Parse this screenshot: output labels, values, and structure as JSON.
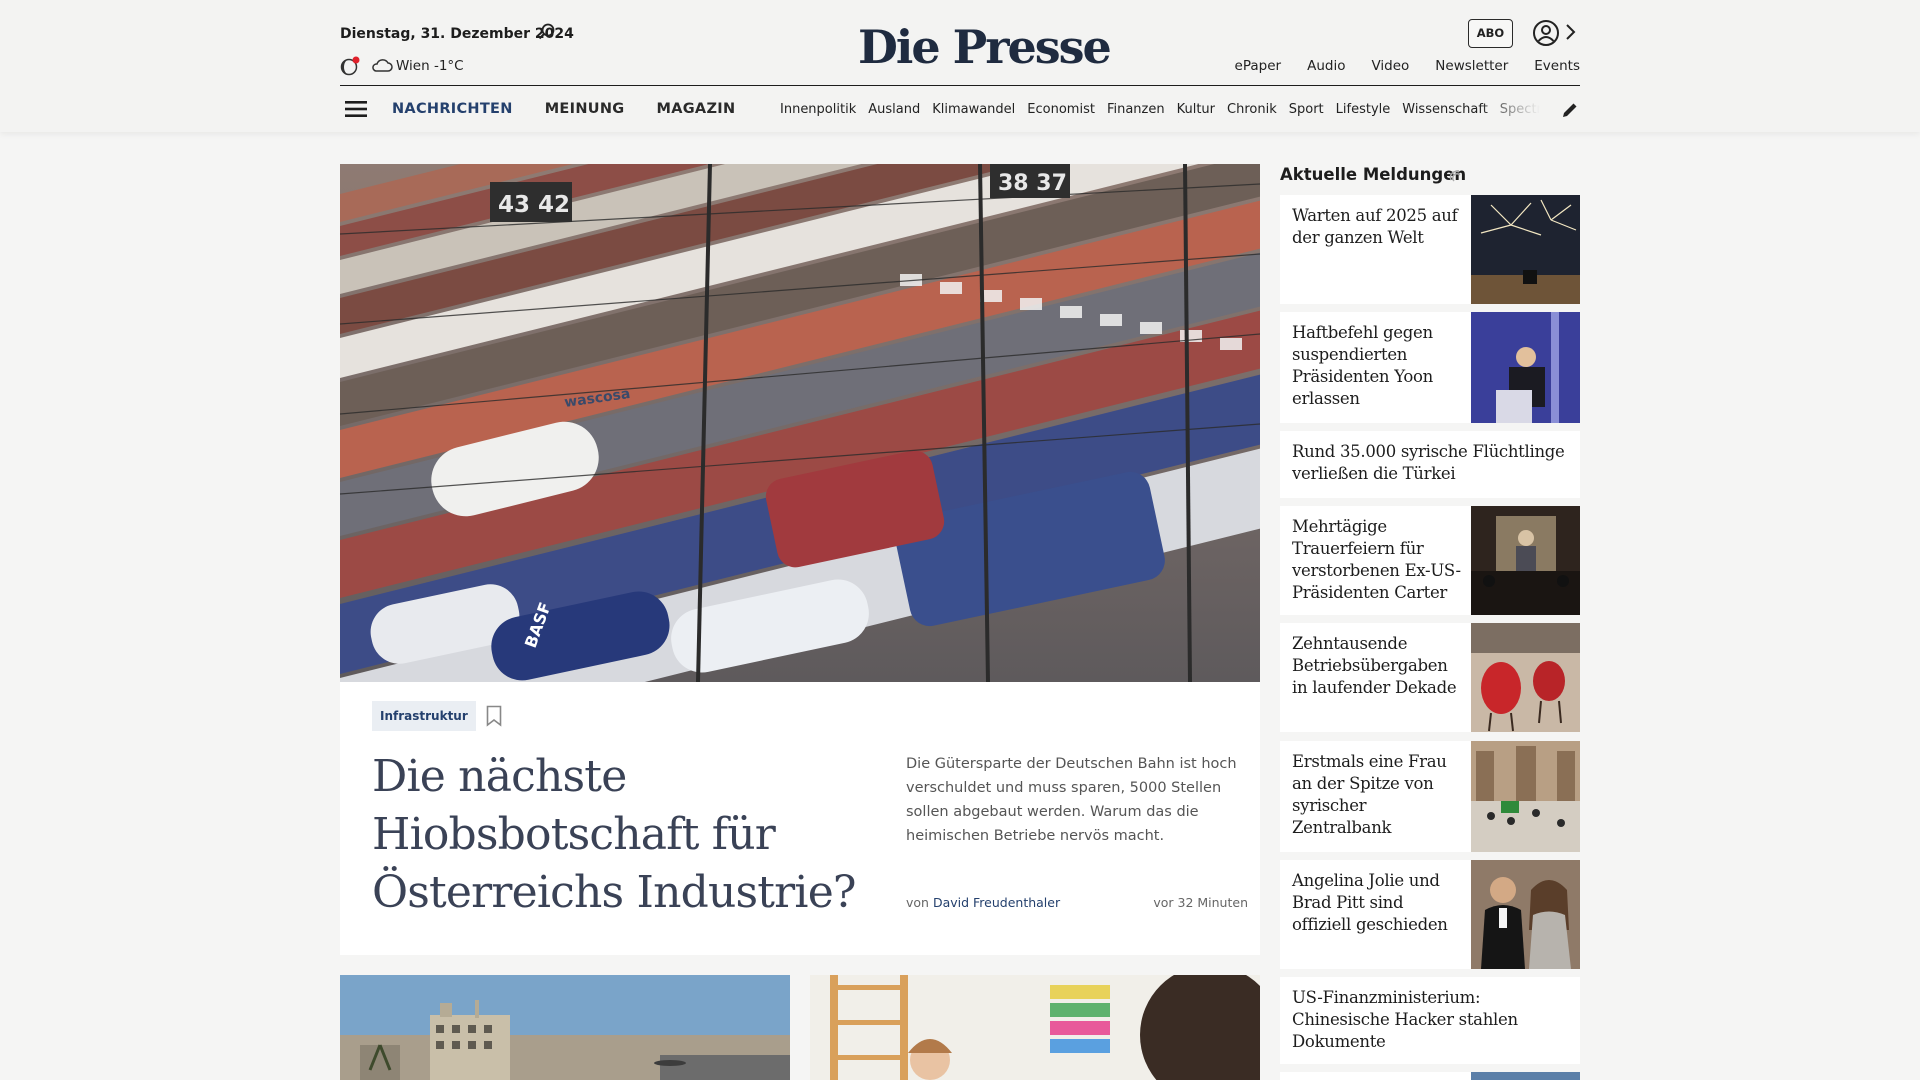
{
  "header": {
    "date": "Dienstag, 31. Dezember 2024",
    "weather": "Wien -1°C",
    "logo": "Die Presse",
    "abo_label": "ABO",
    "top_links": [
      "ePaper",
      "Audio",
      "Video",
      "Newsletter",
      "Events"
    ]
  },
  "main_nav": [
    "NACHRICHTEN",
    "MEINUNG",
    "MAGAZIN"
  ],
  "sub_nav": [
    "Innenpolitik",
    "Ausland",
    "Klimawandel",
    "Economist",
    "Finanzen",
    "Kultur",
    "Chronik",
    "Sport",
    "Lifestyle",
    "Wissenschaft",
    "Spectrum"
  ],
  "hero": {
    "tag": "Infrastruktur",
    "title": "Die nächste Hiobsbotschaft für Österreichs Industrie?",
    "teaser": "Die Gütersparte der Deutschen Bahn ist hoch verschuldet und muss sparen, 5000 Stellen sollen abgebaut werden. Warum das die heimischen Betriebe nervös macht.",
    "byline_prefix": "von",
    "author": "David Freudenthaler",
    "time": "vor 32 Minuten",
    "image_signs": [
      "43 42",
      "38 37"
    ],
    "image_wagon_labels": [
      "wascosa",
      "BASF"
    ]
  },
  "sidebar": {
    "heading": "Aktuelle Meldungen",
    "items": [
      {
        "title": "Warten auf 2025 auf der ganzen Welt",
        "thumb": "fireworks"
      },
      {
        "title": "Haftbefehl gegen suspendierten Präsidenten Yoon erlassen",
        "thumb": "speaker-podium"
      },
      {
        "title": "Rund 35.000 syrische Flüchtlinge verließen die Türkei",
        "thumb": ""
      },
      {
        "title": "Mehrtägige Trauerfeiern für verstorbenen Ex-US-Präsidenten Carter",
        "thumb": "memorial"
      },
      {
        "title": "Zehntausende Betriebsübergaben in laufender Dekade",
        "thumb": "cafe-chairs"
      },
      {
        "title": "Erstmals eine Frau an der Spitze von syrischer Zentralbank",
        "thumb": "mosque-crowd"
      },
      {
        "title": "Angelina Jolie und Brad Pitt sind offiziell geschieden",
        "thumb": "couple"
      },
      {
        "title": "US-Finanzministerium: Chinesische Hacker stahlen Dokumente",
        "thumb": ""
      }
    ]
  },
  "colors": {
    "brand": "#1f2b40",
    "accent": "#24406d",
    "background": "#f5f5f4"
  }
}
